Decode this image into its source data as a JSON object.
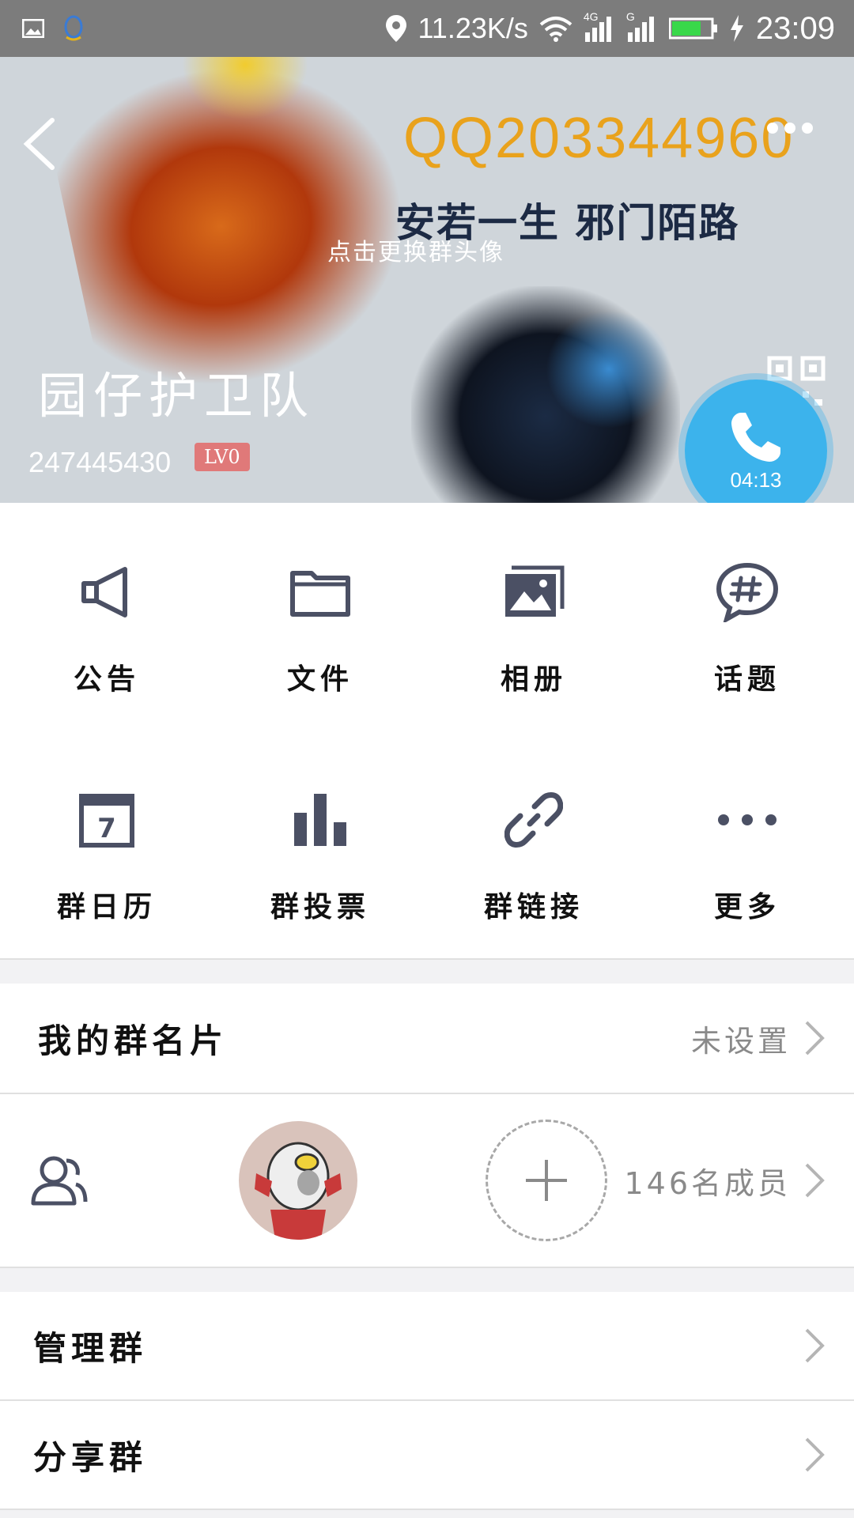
{
  "status_bar": {
    "net_speed": "11.23K/s",
    "time": "23:09",
    "network_labels": [
      "4G",
      "G"
    ]
  },
  "header": {
    "qq_text": "QQ203344960",
    "slogan": "安若一生 邪门陌路",
    "change_avatar_hint": "点击更换群头像",
    "group_name": "园仔护卫队",
    "group_id": "247445430",
    "level": "LV0",
    "call_timer": "04:13",
    "colors": {
      "call": "#3cb3ec",
      "badge": "#e07979"
    }
  },
  "features": [
    {
      "label": "公告",
      "icon": "megaphone-icon"
    },
    {
      "label": "文件",
      "icon": "folder-icon"
    },
    {
      "label": "相册",
      "icon": "album-icon"
    },
    {
      "label": "话题",
      "icon": "topic-icon"
    },
    {
      "label": "群日历",
      "icon": "calendar-icon"
    },
    {
      "label": "群投票",
      "icon": "vote-icon"
    },
    {
      "label": "群链接",
      "icon": "link-icon"
    },
    {
      "label": "更多",
      "icon": "more-icon"
    }
  ],
  "calendar_day": "7",
  "my_card": {
    "title": "我的群名片",
    "value": "未设置"
  },
  "members": {
    "count_text": "146名成员"
  },
  "manage": {
    "title": "管理群"
  },
  "share": {
    "title": "分享群"
  }
}
